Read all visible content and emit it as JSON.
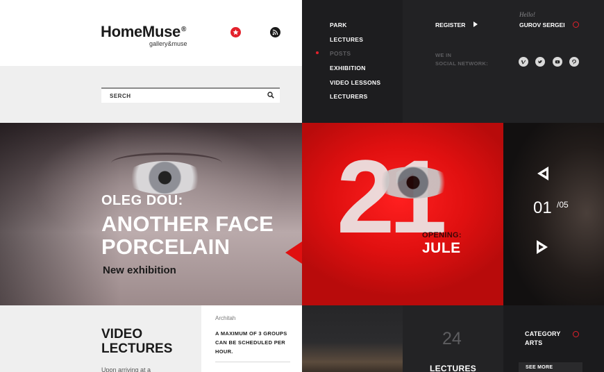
{
  "header": {
    "logo": "HomeMuse",
    "logo_mark": "®",
    "logo_sub": "gallery&muse",
    "icons": [
      "star-icon",
      "rss-icon"
    ]
  },
  "search": {
    "placeholder": "SERCH",
    "icon": "search-icon"
  },
  "nav": {
    "items": [
      {
        "label": "PARK",
        "active": false
      },
      {
        "label": "LECTURES",
        "active": false
      },
      {
        "label": "POSTS",
        "active": true
      },
      {
        "label": "EXHIBITION",
        "active": false
      },
      {
        "label": "VIDEO LESSONS",
        "active": false
      },
      {
        "label": "LECTURERS",
        "active": false
      }
    ]
  },
  "account": {
    "register": "REGISTER",
    "greeting": "Hello!",
    "user": "GUROV SERGEI"
  },
  "social": {
    "label_line1": "WE IN",
    "label_line2": "SOCIAL NETWORK:",
    "icons": [
      "vimeo-icon",
      "twitter-icon",
      "youtube-icon",
      "pinterest-icon"
    ]
  },
  "hero": {
    "artist": "OLEG DOU:",
    "title_line1": "ANOTHER FACE",
    "title_line2": "PORCELAIN",
    "subtitle": "New exhibition",
    "day": "21",
    "opening_label": "OPENING:",
    "month": "JULE",
    "slide_current": "01",
    "slide_total": "/05"
  },
  "video": {
    "title_line1": "VIDEO",
    "title_line2": "LECTURES",
    "teaser": "Upon arriving at a"
  },
  "card": {
    "author": "Architah",
    "text": "A MAXIMUM OF 3 GROUPS CAN BE SCHEDULED PER HOUR."
  },
  "lectures": {
    "count": "24",
    "label": "LECTURES"
  },
  "category": {
    "line1": "CATEGORY",
    "line2": "ARTS",
    "see_more": "SEE MORE"
  },
  "colors": {
    "accent": "#e3212b",
    "dark": "#1d1d1f",
    "light": "#efefef"
  }
}
